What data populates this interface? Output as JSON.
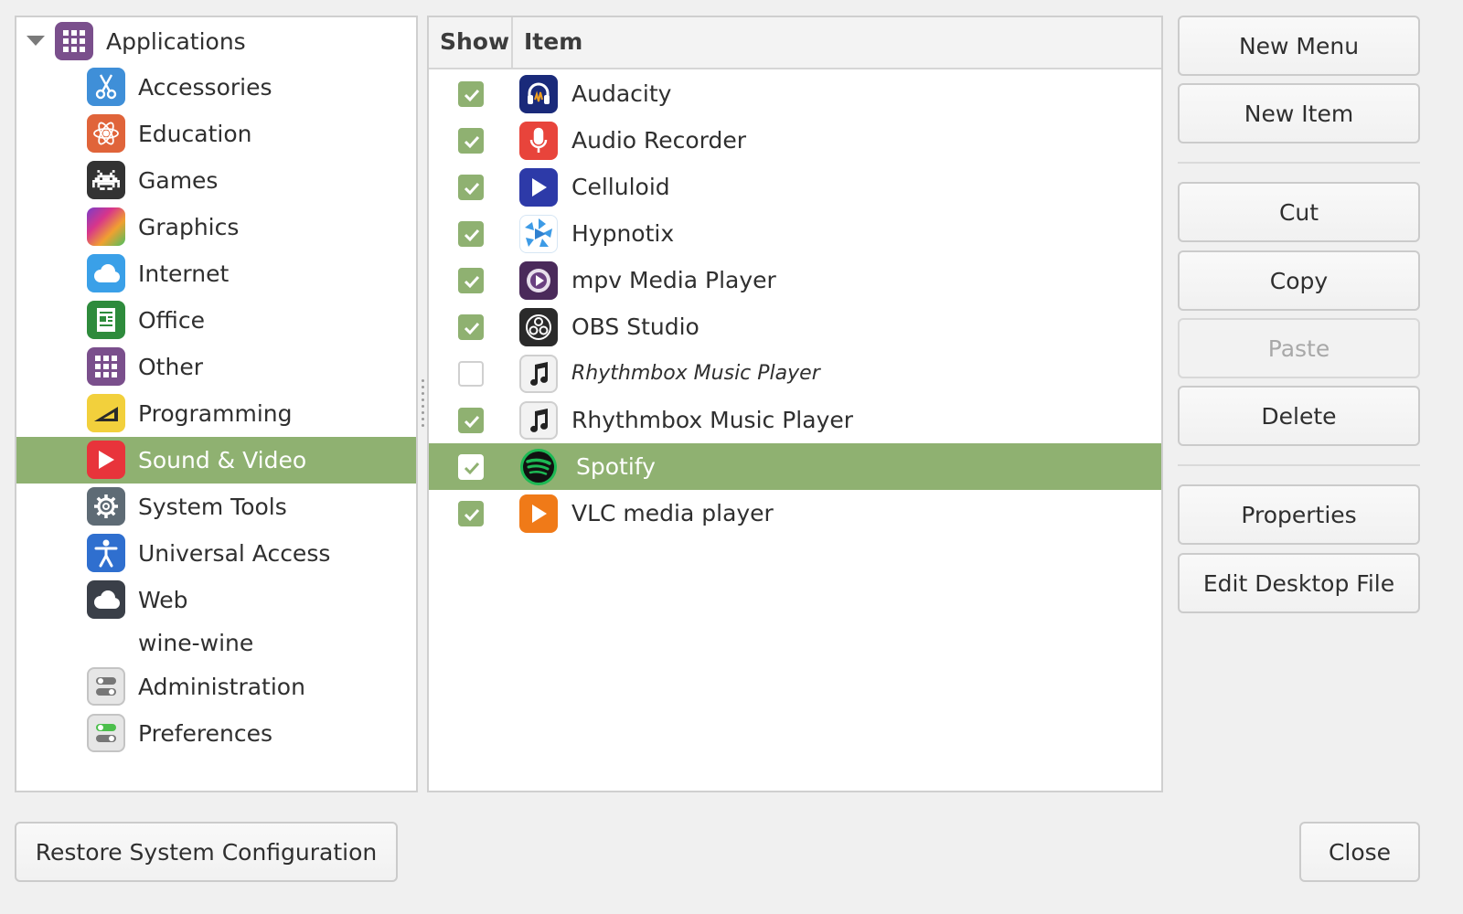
{
  "tree": {
    "root": {
      "label": "Applications",
      "icon": "grid-icon"
    },
    "items": [
      {
        "label": "Accessories",
        "icon": "scissors-icon",
        "color": "#3f8fd8"
      },
      {
        "label": "Education",
        "icon": "atom-icon",
        "color": "#e0643a"
      },
      {
        "label": "Games",
        "icon": "space-invader-icon",
        "color": "#333333"
      },
      {
        "label": "Graphics",
        "icon": "color-gradient-icon",
        "color": "#c03fa8"
      },
      {
        "label": "Internet",
        "icon": "cloud-icon",
        "color": "#3aa0e8"
      },
      {
        "label": "Office",
        "icon": "document-icon",
        "color": "#2e8b3c"
      },
      {
        "label": "Other",
        "icon": "grid-icon",
        "color": "#7a4f8c"
      },
      {
        "label": "Programming",
        "icon": "ruler-triangle-icon",
        "color": "#f2d03c"
      },
      {
        "label": "Sound & Video",
        "icon": "play-icon",
        "color": "#e8343b",
        "selected": true
      },
      {
        "label": "System Tools",
        "icon": "gear-icon",
        "color": "#5e6b75"
      },
      {
        "label": "Universal Access",
        "icon": "accessibility-icon",
        "color": "#2f6fcf"
      },
      {
        "label": "Web",
        "icon": "cloud-icon",
        "color": "#3a3f48"
      },
      {
        "label": "wine-wine",
        "icon": "",
        "color": ""
      },
      {
        "label": "Administration",
        "icon": "toggle-icon",
        "color": "#e6e6e6"
      },
      {
        "label": "Preferences",
        "icon": "toggle-icon",
        "color": "#e6e6e6"
      }
    ]
  },
  "list": {
    "header": {
      "show": "Show",
      "item": "Item"
    },
    "rows": [
      {
        "label": "Audacity",
        "checked": true,
        "icon": "headphones-icon"
      },
      {
        "label": "Audio Recorder",
        "checked": true,
        "icon": "microphone-icon"
      },
      {
        "label": "Celluloid",
        "checked": true,
        "icon": "play-icon"
      },
      {
        "label": "Hypnotix",
        "checked": true,
        "icon": "hypnotix-icon"
      },
      {
        "label": "mpv Media Player",
        "checked": true,
        "icon": "play-circle-icon"
      },
      {
        "label": "OBS Studio",
        "checked": true,
        "icon": "obs-icon"
      },
      {
        "label": "Rhythmbox Music Player",
        "checked": false,
        "icon": "music-note-icon",
        "italic": true
      },
      {
        "label": "Rhythmbox Music Player",
        "checked": true,
        "icon": "music-note-icon"
      },
      {
        "label": "Spotify",
        "checked": true,
        "icon": "spotify-icon",
        "selected": true
      },
      {
        "label": "VLC media player",
        "checked": true,
        "icon": "cone-play-icon"
      }
    ]
  },
  "buttons": {
    "new_menu": "New Menu",
    "new_item": "New Item",
    "cut": "Cut",
    "copy": "Copy",
    "paste": "Paste",
    "delete": "Delete",
    "properties": "Properties",
    "edit_desktop_file": "Edit Desktop File",
    "restore": "Restore System Configuration",
    "close": "Close"
  },
  "colors": {
    "selection": "#8fb171",
    "accent_green": "#8fb171"
  }
}
